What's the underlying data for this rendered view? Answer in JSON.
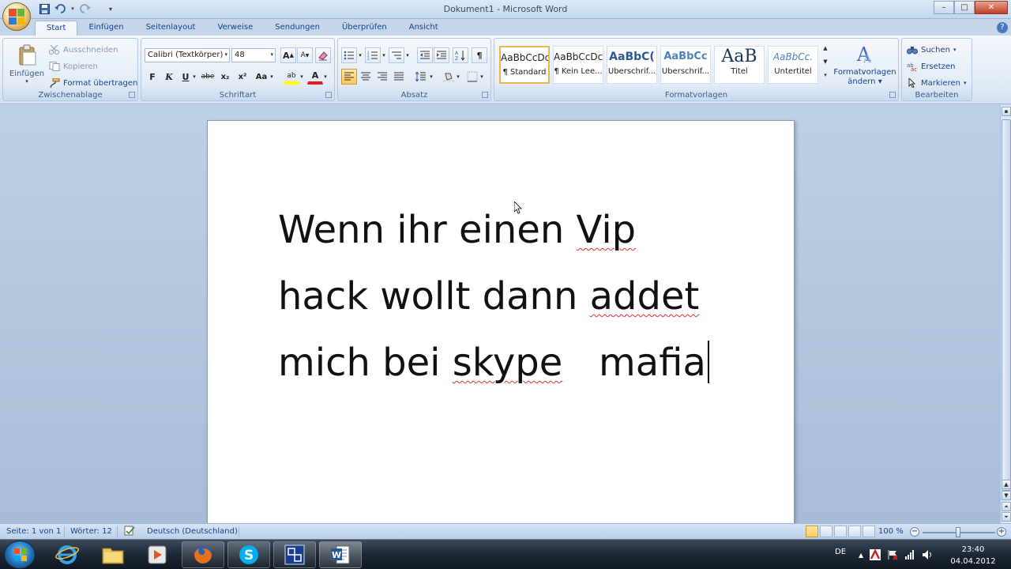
{
  "window": {
    "title": "Dokument1 - Microsoft Word",
    "minimize": "–",
    "maximize": "□",
    "close": "✕"
  },
  "tabs": [
    "Start",
    "Einfügen",
    "Seitenlayout",
    "Verweise",
    "Sendungen",
    "Überprüfen",
    "Ansicht"
  ],
  "active_tab": "Start",
  "ribbon": {
    "clipboard": {
      "label": "Zwischenablage",
      "paste": "Einfügen",
      "cut": "Ausschneiden",
      "copy": "Kopieren",
      "format_painter": "Format übertragen"
    },
    "font": {
      "label": "Schriftart",
      "font_name": "Calibri (Textkörper)",
      "font_size": "48",
      "grow": "A",
      "shrink": "A",
      "bold": "F",
      "italic": "K",
      "underline": "U",
      "strike": "abe",
      "subscript": "x₂",
      "superscript": "x²",
      "case": "Aa",
      "highlight": "ab",
      "color": "A"
    },
    "paragraph": {
      "label": "Absatz",
      "show_marks": "¶"
    },
    "styles": {
      "label": "Formatvorlagen",
      "items": [
        {
          "preview": "AaBbCcDc",
          "name": "¶ Standard"
        },
        {
          "preview": "AaBbCcDc",
          "name": "¶ Kein Lee..."
        },
        {
          "preview": "AaBbC(",
          "name": "Überschrif..."
        },
        {
          "preview": "AaBbCc",
          "name": "Überschrif..."
        },
        {
          "preview": "AaB",
          "name": "Titel"
        },
        {
          "preview": "AaBbCc.",
          "name": "Untertitel"
        }
      ],
      "change_styles_1": "Formatvorlagen",
      "change_styles_2": "ändern"
    },
    "editing": {
      "label": "Bearbeiten",
      "find": "Suchen",
      "replace": "Ersetzen",
      "select": "Markieren"
    }
  },
  "document": {
    "lines": [
      [
        {
          "t": "Wenn ihr einen ",
          "s": false
        },
        {
          "t": "Vip",
          "s": true
        }
      ],
      [
        {
          "t": "hack wollt dann ",
          "s": false
        },
        {
          "t": "addet",
          "s": true
        }
      ],
      [
        {
          "t": "mich bei ",
          "s": false
        },
        {
          "t": "skype",
          "s": true
        },
        {
          "t": "   mafia",
          "s": false
        }
      ]
    ]
  },
  "status": {
    "page": "Seite: 1 von 1",
    "words": "Wörter: 12",
    "language": "Deutsch (Deutschland)",
    "zoom": "100 %",
    "zoom_minus": "−",
    "zoom_plus": "+"
  },
  "taskbar": {
    "lang": "DE",
    "time": "23:40",
    "date": "04.04.2012"
  },
  "colors": {
    "accent": "#15428b",
    "ribbon_bg": "#dbe6f4",
    "spell_error": "#e03030",
    "taskbar": "#1d2836"
  }
}
